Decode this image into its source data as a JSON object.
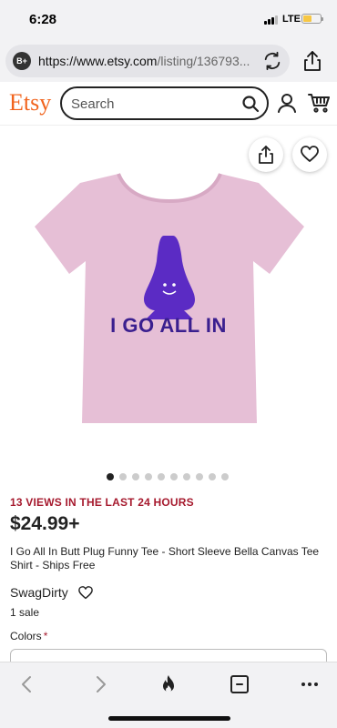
{
  "status_bar": {
    "time": "6:28",
    "network": "LTE"
  },
  "browser": {
    "profile_badge": "B+",
    "url_main": "https://www.etsy.com",
    "url_rest": "/listing/136793..."
  },
  "header": {
    "logo": "Etsy",
    "search_placeholder": "Search"
  },
  "product": {
    "image_slogan": "I GO ALL IN",
    "image_count": 10,
    "active_image": 0,
    "views_notice": "13 VIEWS IN THE LAST 24 HOURS",
    "price": "$24.99+",
    "title": "I Go All In Butt Plug Funny Tee - Short Sleeve Bella Canvas Tee Shirt - Ships Free",
    "shop_name": "SwagDirty",
    "sales": "1 sale",
    "option_label": "Colors",
    "required_mark": "*"
  },
  "colors": {
    "shirt": "#e6bfd6",
    "accent": "#f1641e",
    "alert": "#a61a2e",
    "print": "#3a1f8f"
  }
}
